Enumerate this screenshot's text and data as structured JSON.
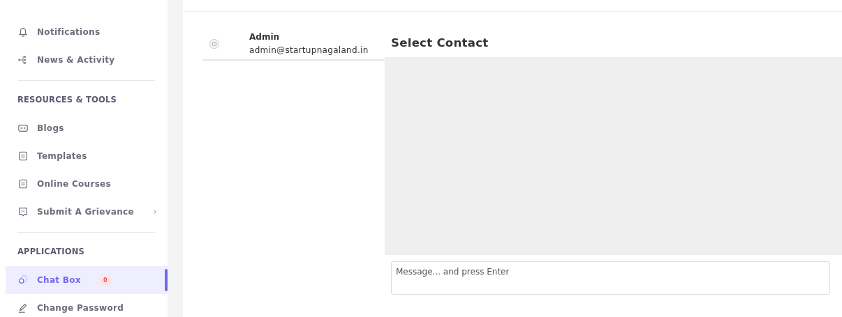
{
  "sidebar": {
    "sections": [
      {
        "kind": "item",
        "label": "Notifications",
        "selected": false
      },
      {
        "kind": "item",
        "label": "News & Activity",
        "selected": false
      },
      {
        "kind": "divider"
      },
      {
        "kind": "heading",
        "label": "RESOURCES & TOOLS"
      },
      {
        "kind": "item",
        "label": "Blogs",
        "selected": false
      },
      {
        "kind": "item",
        "label": "Templates",
        "selected": false
      },
      {
        "kind": "item",
        "label": "Online Courses",
        "selected": false
      },
      {
        "kind": "item",
        "label": "Submit A Grievance",
        "selected": false,
        "expandable": true
      },
      {
        "kind": "divider"
      },
      {
        "kind": "heading",
        "label": "APPLICATIONS"
      },
      {
        "kind": "item",
        "label": "Chat Box",
        "selected": true,
        "badge": "0"
      },
      {
        "kind": "item",
        "label": "Change Password",
        "selected": false
      }
    ]
  },
  "contacts": [
    {
      "name": "Admin",
      "email": "admin@startupnagaland.in"
    }
  ],
  "chat": {
    "title": "Select Contact",
    "message": {
      "placeholder": "Message... and press Enter"
    }
  }
}
